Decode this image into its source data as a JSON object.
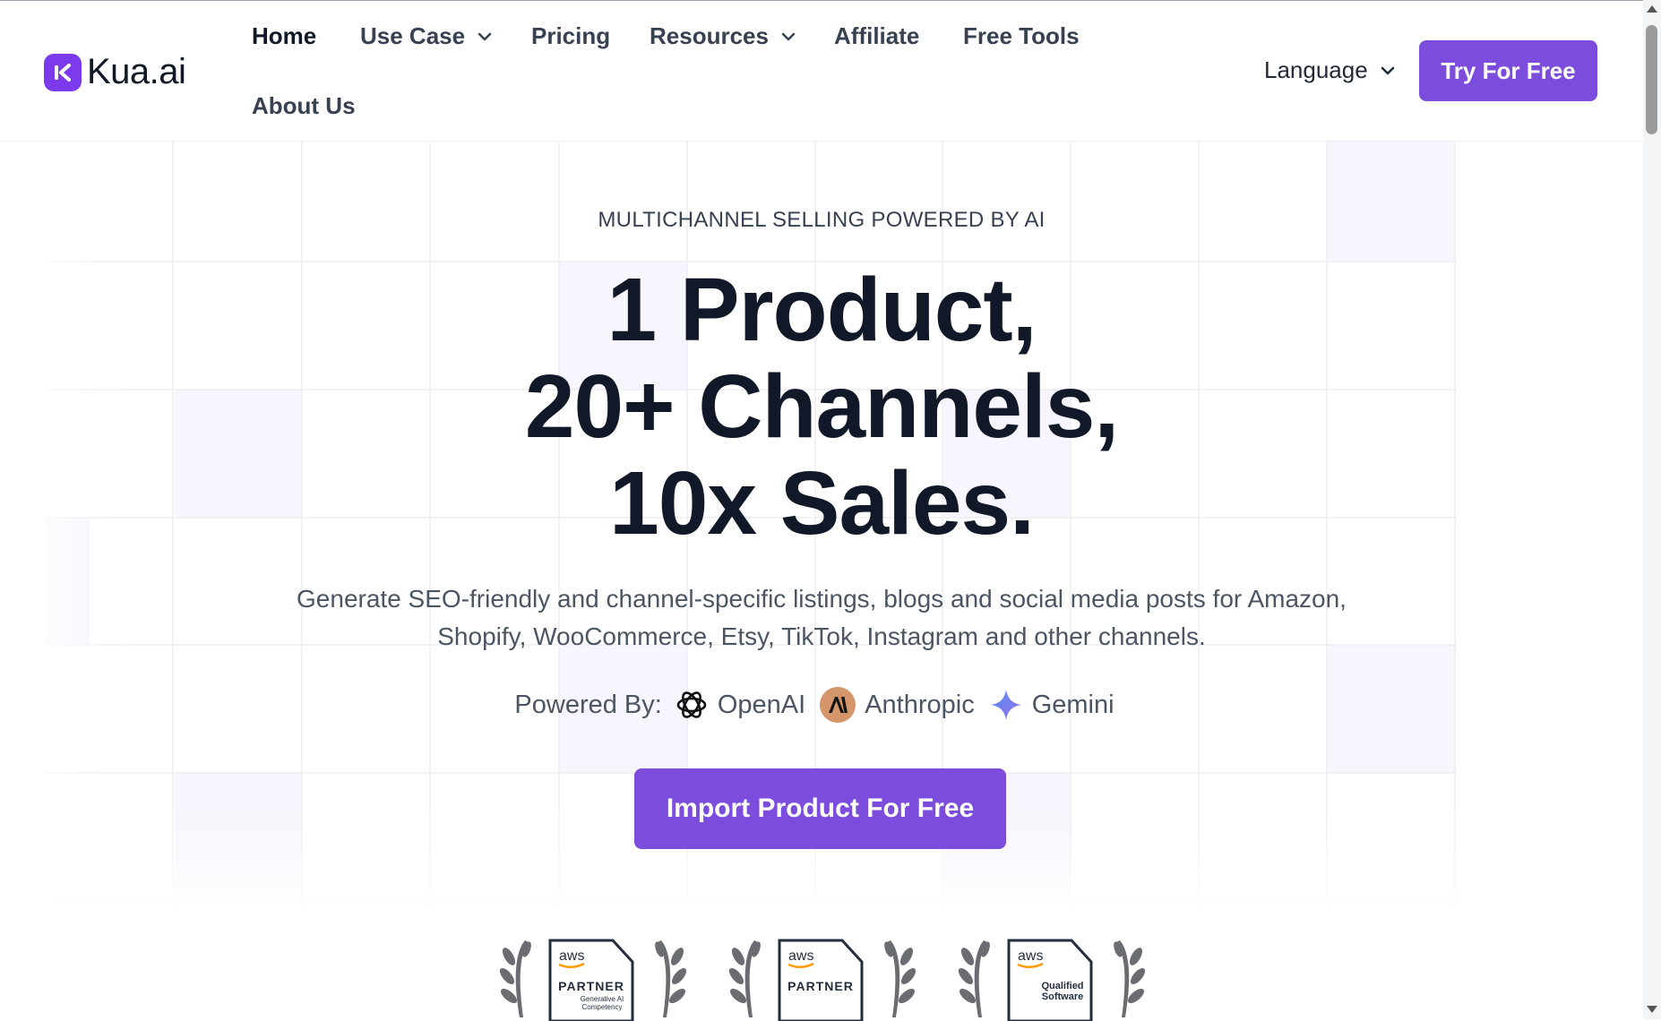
{
  "header": {
    "logo_text": "Kua.ai",
    "nav": [
      {
        "label": "Home"
      },
      {
        "label": "Use Case"
      },
      {
        "label": "Pricing"
      },
      {
        "label": "Resources"
      },
      {
        "label": "Affiliate"
      },
      {
        "label": "Free Tools"
      },
      {
        "label": "About Us"
      }
    ],
    "language_label": "Language",
    "try_label": "Try For Free"
  },
  "hero": {
    "eyebrow": "MULTICHANNEL SELLING POWERED BY AI",
    "headline": [
      "1 Product,",
      "20+ Channels,",
      "10x Sales."
    ],
    "subtitle_lines": [
      "Generate SEO-friendly and channel-specific listings, blogs and social media posts for Amazon,",
      "Shopify, WooCommerce, Etsy, TikTok, Instagram and other channels."
    ],
    "powered_label": "Powered By:",
    "powered_brands": [
      {
        "name": "OpenAI",
        "icon": "openai-icon"
      },
      {
        "name": "Anthropic",
        "icon": "anthropic-icon"
      },
      {
        "name": "Gemini",
        "icon": "gemini-icon"
      }
    ],
    "cta_label": "Import Product For Free"
  },
  "badges": [
    {
      "top": "aws",
      "main": "PARTNER",
      "sub1": "Generative AI",
      "sub2": "Competency"
    },
    {
      "top": "aws",
      "main": "PARTNER",
      "sub1": "",
      "sub2": ""
    },
    {
      "top": "aws",
      "main": "Qualified",
      "sub1": "Software",
      "sub2": ""
    }
  ],
  "colors": {
    "accent": "#7c4ddc",
    "text": "#111827",
    "muted": "#4b5563"
  }
}
